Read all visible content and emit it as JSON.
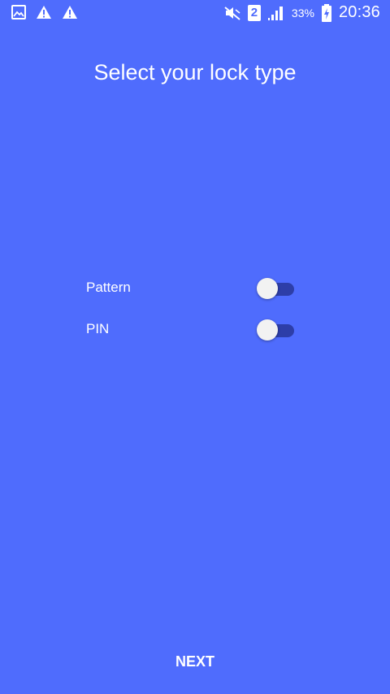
{
  "status_bar": {
    "icons_left": [
      "gallery-icon",
      "warning-icon",
      "warning-icon"
    ],
    "icons_right": [
      "mute-icon",
      "sim-icon",
      "signal-icon",
      "battery-charging-icon"
    ],
    "sim_slot": "2",
    "battery_percent": "33%",
    "time": "20:36"
  },
  "title": "Select your lock type",
  "options": [
    {
      "label": "Pattern",
      "enabled": false
    },
    {
      "label": "PIN",
      "enabled": false
    }
  ],
  "next_label": "NEXT",
  "colors": {
    "background": "#4f6cfd",
    "toggle_track": "#2d3ea8",
    "toggle_thumb": "#f2f2f2",
    "text": "#ffffff"
  }
}
